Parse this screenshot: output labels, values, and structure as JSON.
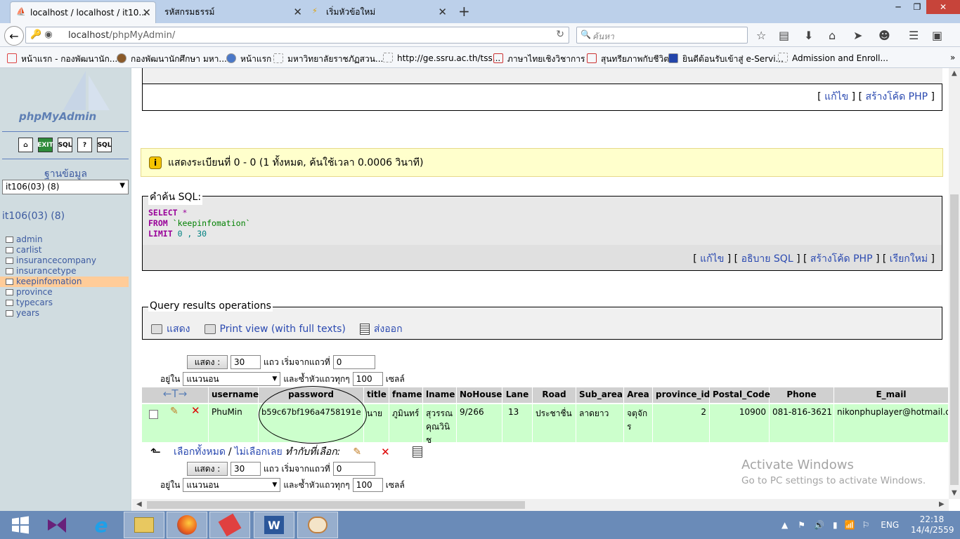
{
  "browser": {
    "tabs": [
      {
        "label": "localhost / localhost / it10...",
        "active": true,
        "icon": "pma-icon"
      },
      {
        "label": "รหัสกรมธรรม์",
        "active": false,
        "icon": ""
      },
      {
        "label": "เริ่มหัวข้อใหม่",
        "active": false,
        "icon": "lightning-icon"
      }
    ],
    "url_host": "localhost",
    "url_path": "/phpMyAdmin/",
    "search_placeholder": "ค้นหา",
    "bookmarks": [
      "หน้าแรก - กองพัฒนานัก...",
      "กองพัฒนานักศึกษา มหา...",
      "หน้าแรก",
      "มหาวิทยาลัยราชภัฏสวน...",
      "http://ge.ssru.ac.th/tss...",
      "ภาษาไทยเชิงวิชาการ",
      "สุนทรียภาพกับชีวิต",
      "ยินดีต้อนรับเข้าสู่ e-Servi...",
      "Admission and Enroll..."
    ]
  },
  "sidebar": {
    "logo": "phpMyAdmin",
    "icons": [
      "home-icon",
      "exit-icon",
      "sql-icon",
      "help-icon",
      "docs-icon"
    ],
    "db_label": "ฐานข้อมูล",
    "db_selected": "it106(03) (8)",
    "db_title": "it106(03) (8)",
    "tables": [
      "admin",
      "carlist",
      "insurancecompany",
      "insurancetype",
      "keepinfomation",
      "province",
      "typecars",
      "years"
    ],
    "selected_table": "keepinfomation"
  },
  "main": {
    "top_links": {
      "edit": "แก้ไข",
      "create_php": "สร้างโค้ด PHP"
    },
    "notice": "แสดงระเบียนที่ 0 - 0 (1 ทั้งหมด, ค้นใช้เวลา 0.0006 วินาที)",
    "sql_legend": "คำค้น SQL:",
    "sql": {
      "select": "SELECT",
      "star": "*",
      "from": "FROM",
      "table": "`keepinfomation`",
      "limit": "LIMIT",
      "limit_value": "0 , 30"
    },
    "sql_links": {
      "edit": "แก้ไข",
      "explain": "อธิบาย SQL",
      "create_php": "สร้างโค้ด PHP",
      "refresh": "เรียกใหม่"
    },
    "qro_legend": "Query results operations",
    "qro_links": {
      "show": "แสดง",
      "print_full": "Print view (with full texts)",
      "export": "ส่งออก"
    },
    "nav": {
      "show_btn": "แสดง :",
      "rows": "30",
      "rows_from": "แถว เริ่มจากแถวที่",
      "start": "0",
      "mode_label": "อยู่ใน",
      "mode": "แนวนอน",
      "repeat_label": "และซ้ำหัวแถวทุกๆ",
      "repeat": "100",
      "cells": "เซลล์"
    },
    "columns": [
      "username",
      "password",
      "title",
      "fname",
      "lname",
      "NoHouse",
      "Lane",
      "Road",
      "Sub_area",
      "Area",
      "province_id",
      "Postal_Code",
      "Phone",
      "E_mail"
    ],
    "sort_arrows": "←T→",
    "row": {
      "username": "PhuMin",
      "password": "b59c67bf196a4758191e",
      "title": "นาย",
      "fname": "ภูมินทร์",
      "lname": "สุวรรณคุณวินิช",
      "NoHouse": "9/266",
      "Lane": "13",
      "Road": "ประชาชื่น",
      "Sub_area": "ลาดยาว",
      "Area": "จตุจักร",
      "province_id": "2",
      "Postal_Code": "10900",
      "Phone": "081-816-3621",
      "E_mail": "nikonphuplayer@hotmail.com"
    },
    "select_all": "เลือกทั้งหมด",
    "separator": "/",
    "deselect_all": "ไม่เลือกเลย",
    "with_selected": "ทำกับที่เลือก:"
  },
  "watermark": {
    "line1": "Activate Windows",
    "line2": "Go to PC settings to activate Windows."
  },
  "taskbar": {
    "apps": [
      "start-icon",
      "visual-studio-icon",
      "ie-icon",
      "file-explorer-icon",
      "firefox-icon",
      "paint-tool-icon",
      "word-icon",
      "paint-icon"
    ],
    "lang": "ENG",
    "time": "22:18",
    "date": "14/4/2559"
  }
}
